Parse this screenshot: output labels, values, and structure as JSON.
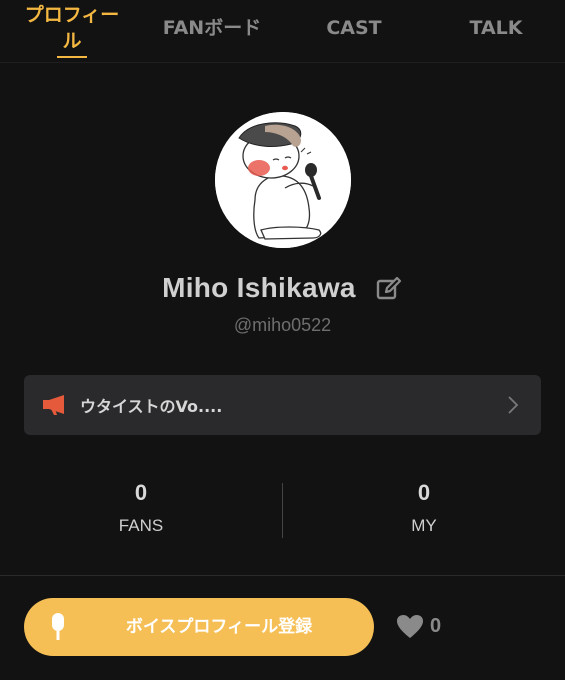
{
  "tabs": [
    {
      "label_line1": "プロフィー",
      "label_line2": "ル"
    },
    {
      "label": "FANボード"
    },
    {
      "label": "CAST"
    },
    {
      "label": "TALK"
    }
  ],
  "profile": {
    "name": "Miho Ishikawa",
    "handle": "@miho0522"
  },
  "announcement": {
    "text": "ウタイストのVo....",
    "icon": "megaphone-icon"
  },
  "stats": [
    {
      "value": "0",
      "label": "FANS"
    },
    {
      "value": "0",
      "label": "MY"
    }
  ],
  "actions": {
    "voice_button_label": "ボイスプロフィール登録",
    "like_count": "0"
  },
  "colors": {
    "accent": "#f4b842",
    "button": "#f5bf55",
    "background": "#121212"
  }
}
